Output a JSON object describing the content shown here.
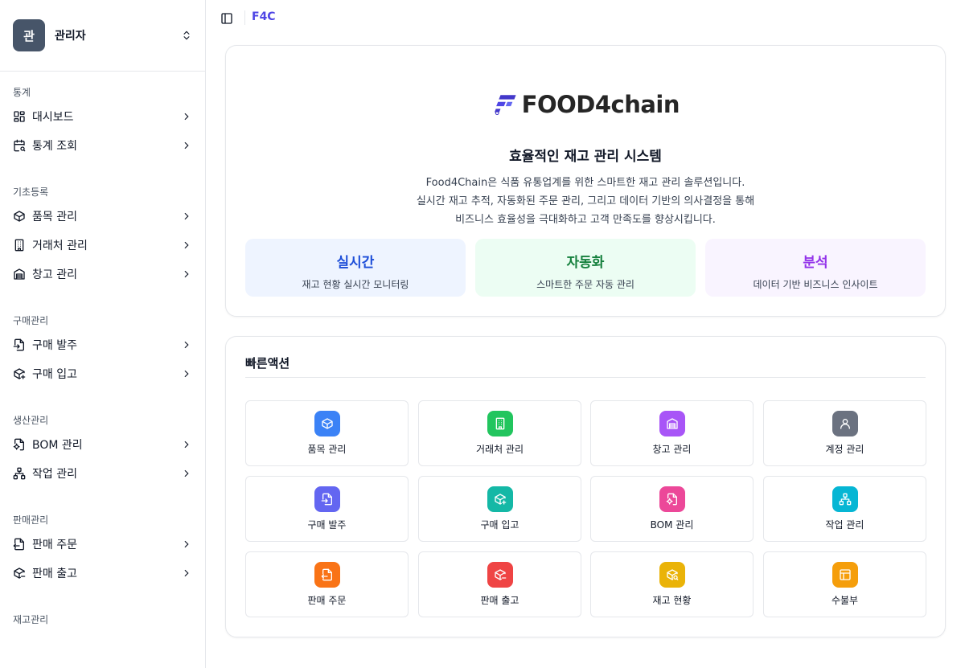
{
  "sidebar": {
    "user": {
      "avatar_initial": "관",
      "name": "관리자"
    },
    "groups": [
      {
        "label": "통계",
        "items": [
          {
            "label": "대시보드",
            "icon": "dashboard-icon"
          },
          {
            "label": "통계 조회",
            "icon": "calendar-search-icon"
          }
        ]
      },
      {
        "label": "기초등록",
        "items": [
          {
            "label": "품목 관리",
            "icon": "box-icon"
          },
          {
            "label": "거래처 관리",
            "icon": "building-icon"
          },
          {
            "label": "창고 관리",
            "icon": "warehouse-icon"
          }
        ]
      },
      {
        "label": "구매관리",
        "items": [
          {
            "label": "구매 발주",
            "icon": "file-import-icon"
          },
          {
            "label": "구매 입고",
            "icon": "package-plus-icon"
          }
        ]
      },
      {
        "label": "생산관리",
        "items": [
          {
            "label": "BOM 관리",
            "icon": "file-cog-icon"
          },
          {
            "label": "작업 관리",
            "icon": "workflow-icon"
          }
        ]
      },
      {
        "label": "판매관리",
        "items": [
          {
            "label": "판매 주문",
            "icon": "file-export-icon"
          },
          {
            "label": "판매 출고",
            "icon": "package-minus-icon"
          }
        ]
      },
      {
        "label": "재고관리",
        "items": []
      }
    ]
  },
  "topbar": {
    "breadcrumb": "F4C",
    "toggle_icon": "sidebar-toggle-icon"
  },
  "hero": {
    "logo_text": "FOOD4chain",
    "title": "효율적인 재고 관리 시스템",
    "description": [
      "Food4Chain은 식품 유통업계를 위한 스마트한 재고 관리 솔루션입니다.",
      "실시간 재고 추적, 자동화된 주문 관리, 그리고 데이터 기반의 의사결정을 통해",
      "비즈니스 효율성을 극대화하고 고객 만족도를 향상시킵니다."
    ],
    "features": [
      {
        "title": "실시간",
        "subtitle": "재고 현황 실시간 모니터링",
        "bg": "#eef4ff",
        "color": "#1d4ed8"
      },
      {
        "title": "자동화",
        "subtitle": "스마트한 주문 자동 관리",
        "bg": "#ecfdf3",
        "color": "#15803d"
      },
      {
        "title": "분석",
        "subtitle": "데이터 기반 비즈니스 인사이트",
        "bg": "#f9f4ff",
        "color": "#9333ea"
      }
    ]
  },
  "quick_actions": {
    "title": "빠른액션",
    "items": [
      {
        "label": "품목 관리",
        "icon": "box-icon",
        "color": "#3b82f6"
      },
      {
        "label": "거래처 관리",
        "icon": "building-icon",
        "color": "#22c55e"
      },
      {
        "label": "창고 관리",
        "icon": "warehouse-icon",
        "color": "#a855f7"
      },
      {
        "label": "계정 관리",
        "icon": "user-icon",
        "color": "#6b7280"
      },
      {
        "label": "구매 발주",
        "icon": "file-import-icon",
        "color": "#6366f1"
      },
      {
        "label": "구매 입고",
        "icon": "package-plus-icon",
        "color": "#14b8a6"
      },
      {
        "label": "BOM 관리",
        "icon": "file-cog-icon",
        "color": "#ec4899"
      },
      {
        "label": "작업 관리",
        "icon": "workflow-icon",
        "color": "#06b6d4"
      },
      {
        "label": "판매 주문",
        "icon": "file-export-icon",
        "color": "#f97316"
      },
      {
        "label": "판매 출고",
        "icon": "package-minus-icon",
        "color": "#ef4444"
      },
      {
        "label": "재고 현황",
        "icon": "package-search-icon",
        "color": "#eab308"
      },
      {
        "label": "수불부",
        "icon": "ledger-icon",
        "color": "#f59e0b"
      }
    ]
  }
}
